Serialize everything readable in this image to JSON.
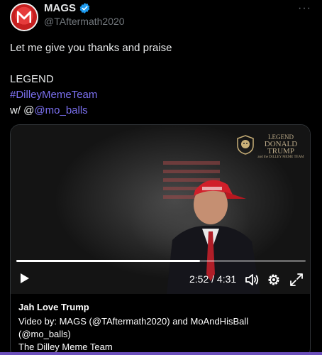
{
  "author": {
    "name": "MAGS",
    "handle": "@TAftermath2020",
    "avatar_icon": "m-logo-icon",
    "verified": true
  },
  "more_menu_label": "···",
  "tweet": {
    "line1": "Let me give you thanks and praise",
    "line2": "LEGEND",
    "hashtag": "#DilleyMemeTeam",
    "with_prefix": "w/ @",
    "mention": "@mo_balls"
  },
  "video": {
    "watermark_line1": "LEGEND",
    "watermark_line2": "DONALD TRUMP",
    "watermark_line3": "and the DILLEY MEME TEAM",
    "time_display": "2:52 / 4:31",
    "progress": 0.634,
    "controls": [
      "play-icon",
      "volume-icon",
      "settings-icon",
      "fullscreen-icon"
    ]
  },
  "card": {
    "title": "Jah Love Trump",
    "desc_line1": "Video by: MAGS (@TAftermath2020) and MoAndHisBall",
    "desc_line2": "(@mo_balls)",
    "desc_line3": "The Dilley Meme Team"
  },
  "colors": {
    "link": "#7b70f0",
    "verified": "#1d9bf0",
    "background": "#000000",
    "accent_bar": "#6b4fbb"
  }
}
